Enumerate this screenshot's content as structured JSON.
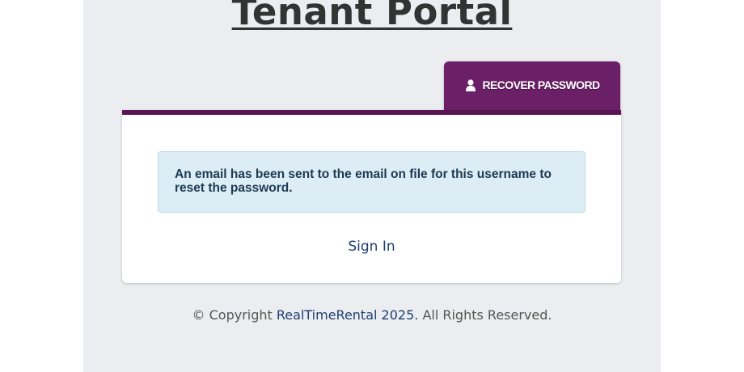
{
  "header": {
    "title": "Tenant Portal"
  },
  "tab": {
    "icon": "user-icon",
    "label": "RECOVER PASSWORD"
  },
  "alert": {
    "message": "An email has been sent to the email on file for this username to reset the password."
  },
  "links": {
    "sign_in": "Sign In"
  },
  "footer": {
    "prefix": "© Copyright",
    "company": "RealTimeRental 2025.",
    "suffix": "All Rights Reserved."
  },
  "colors": {
    "brand_purple": "#6b1f66",
    "link_blue": "#1e3f70",
    "alert_bg": "#dcedf6",
    "page_bg": "#ecedf0"
  }
}
